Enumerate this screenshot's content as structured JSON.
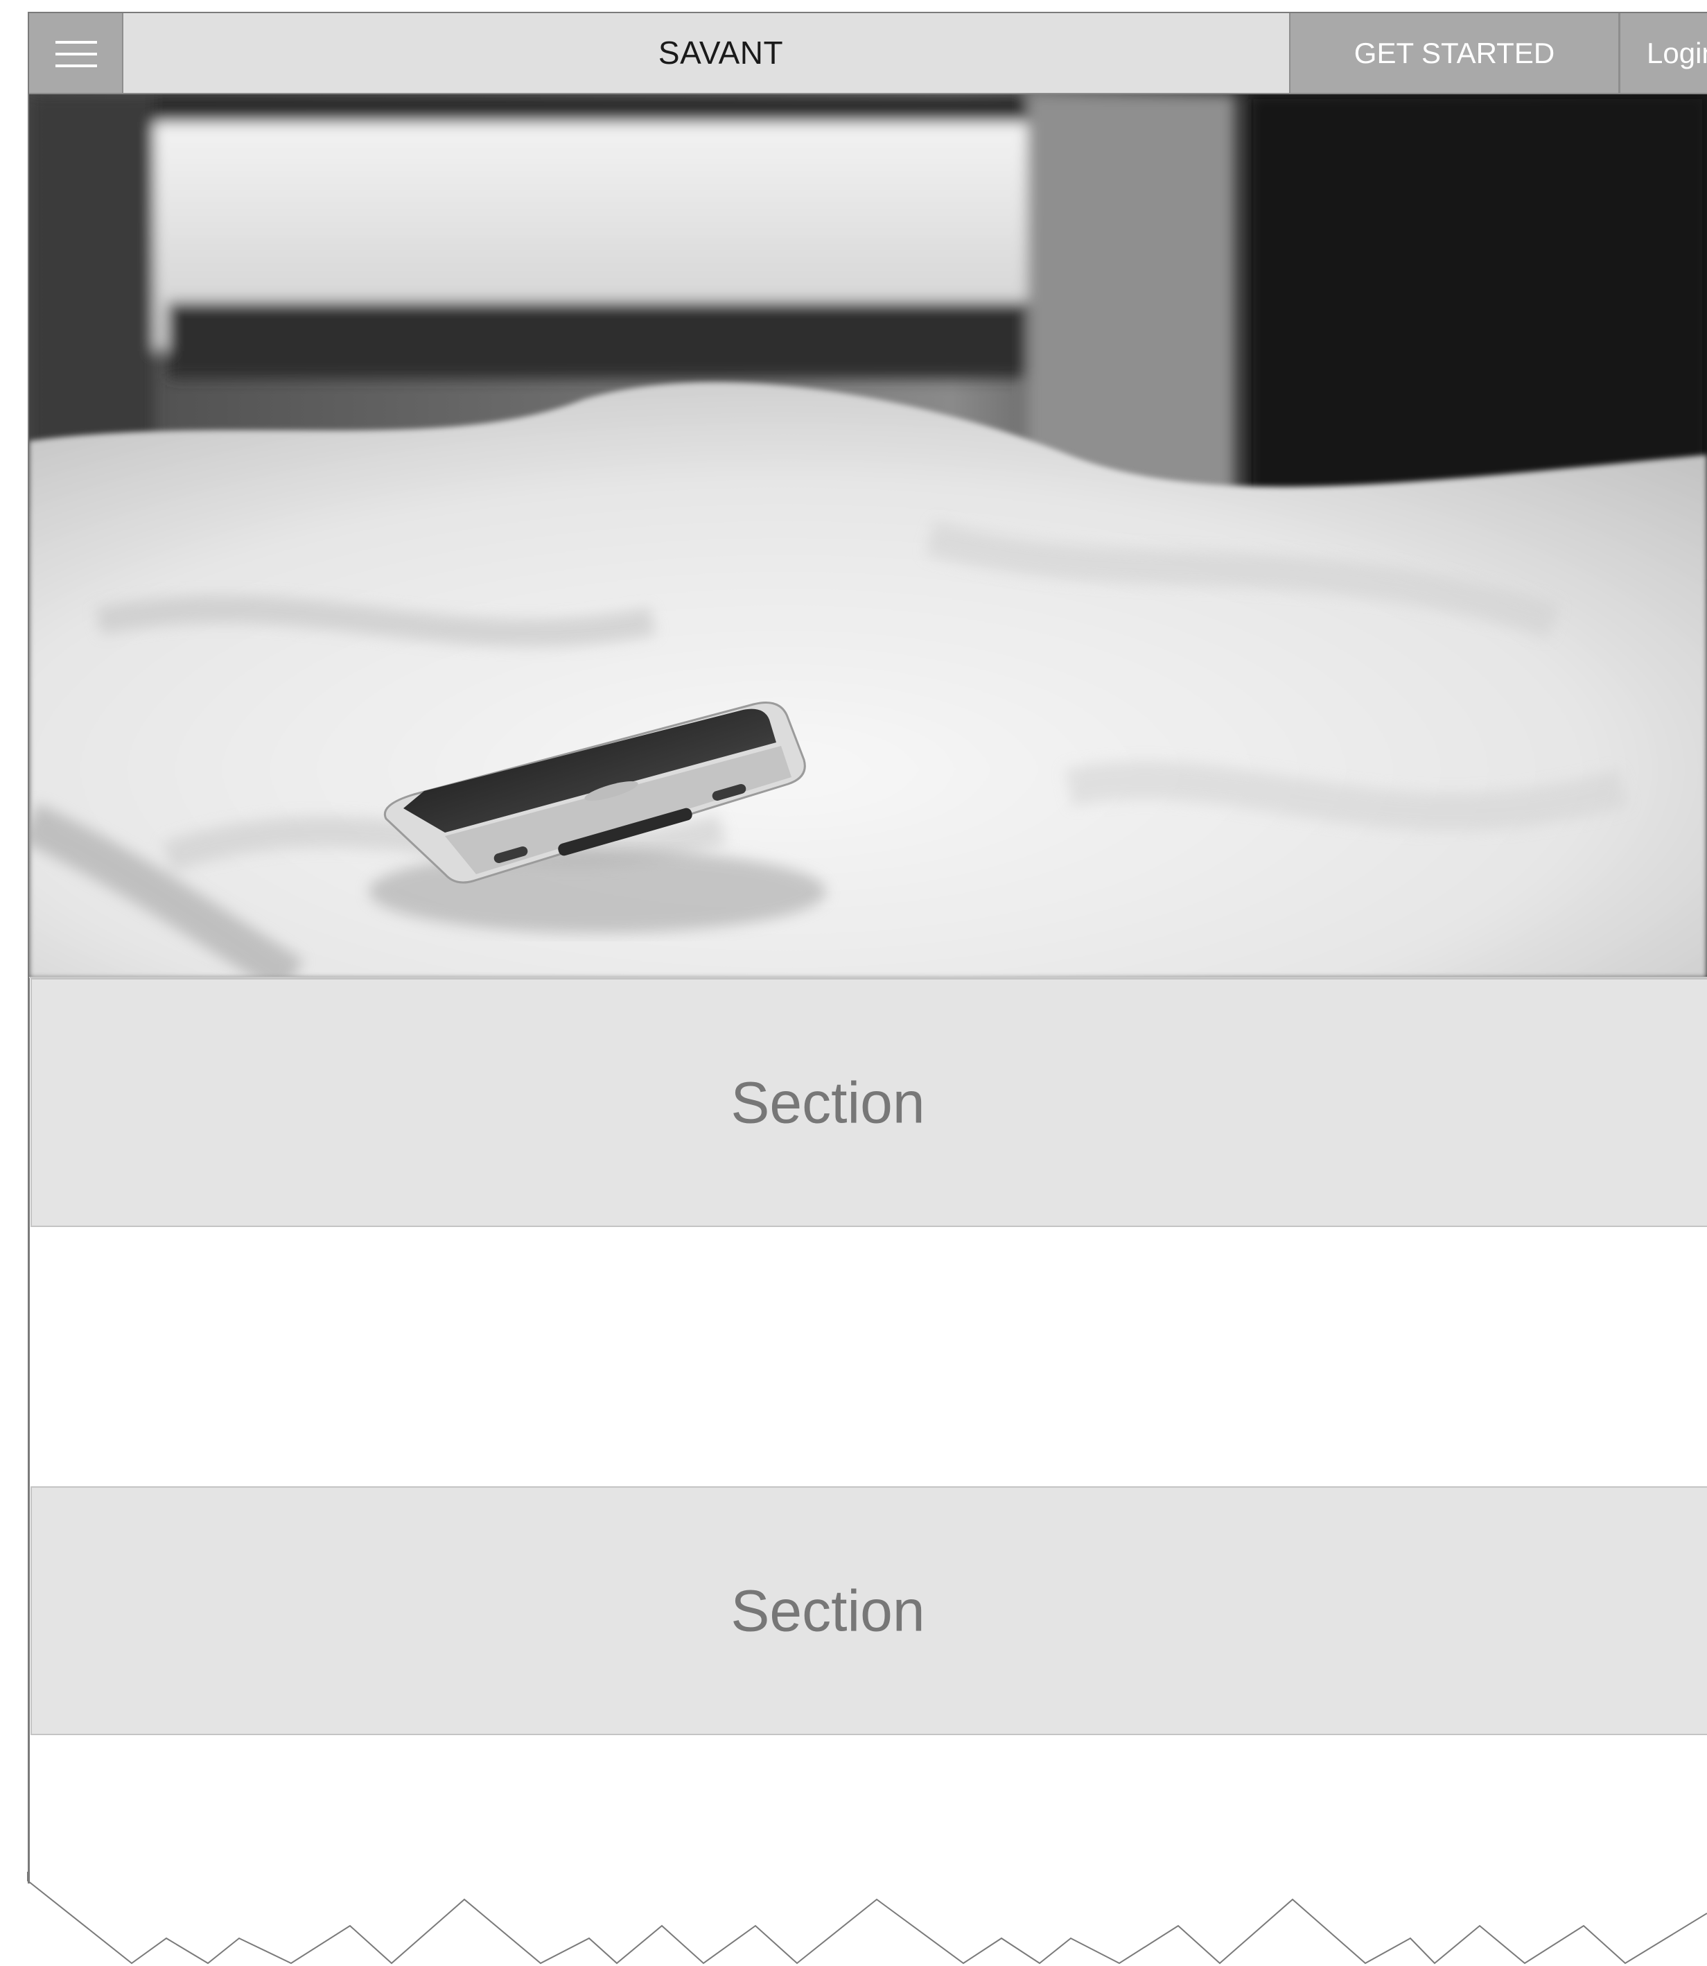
{
  "header": {
    "brand": "SAVANT",
    "get_started_label": "GET STARTED",
    "login_label": "Login",
    "menu_icon": "hamburger-icon"
  },
  "hero": {
    "image": "phone-on-bed-photo"
  },
  "sections": [
    {
      "label": "Section"
    },
    {
      "label": "Section"
    }
  ],
  "colors": {
    "nav_bg": "#e0e0e0",
    "button_bg": "#a9a9a9",
    "section_bg": "#e4e4e4",
    "section_text": "#777777"
  }
}
